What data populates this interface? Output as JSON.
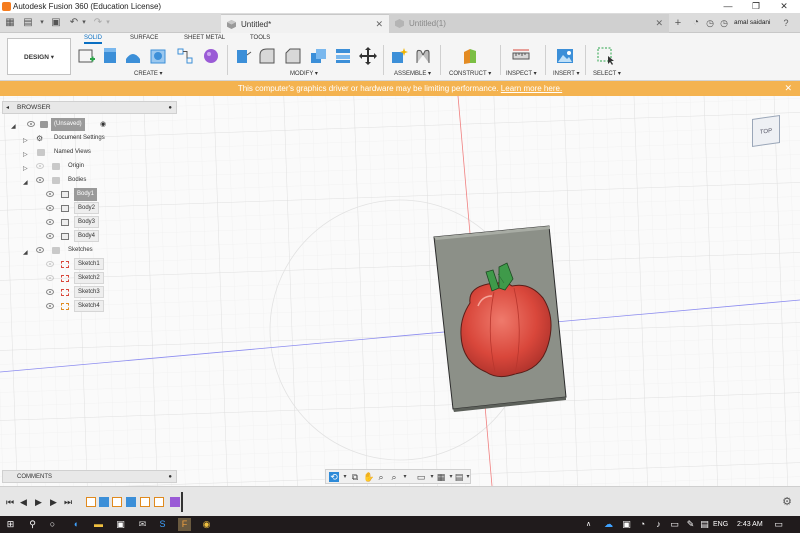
{
  "window": {
    "title": "Autodesk Fusion 360 (Education License)"
  },
  "tabs": [
    {
      "label": "Untitled*"
    },
    {
      "label": "Untitled(1)"
    }
  ],
  "user": {
    "name": "amal saidani"
  },
  "toolbar": {
    "workspace": "DESIGN ▾",
    "workspace_tabs": [
      "SOLID",
      "SURFACE",
      "SHEET METAL",
      "TOOLS"
    ],
    "groups": [
      "CREATE ▾",
      "MODIFY ▾",
      "ASSEMBLE ▾",
      "CONSTRUCT ▾",
      "INSPECT ▾",
      "INSERT ▾",
      "SELECT ▾"
    ]
  },
  "banner": {
    "message": "This computer's graphics driver or hardware may be limiting performance.",
    "link": "Learn more here."
  },
  "browser": {
    "title": "BROWSER",
    "root": "(Unsaved)",
    "items": [
      {
        "label": "Document Settings"
      },
      {
        "label": "Named Views"
      },
      {
        "label": "Origin"
      },
      {
        "label": "Bodies"
      },
      {
        "label": "Body1"
      },
      {
        "label": "Body2"
      },
      {
        "label": "Body3"
      },
      {
        "label": "Body4"
      },
      {
        "label": "Sketches"
      },
      {
        "label": "Sketch1"
      },
      {
        "label": "Sketch2"
      },
      {
        "label": "Sketch3"
      },
      {
        "label": "Sketch4"
      }
    ]
  },
  "viewcube": {
    "face": "TOP"
  },
  "comments": {
    "title": "COMMENTS"
  },
  "taskbar": {
    "lang": "ENG",
    "time": "2:43 AM"
  },
  "colors": {
    "banner": "#f4b350",
    "accent": "#0a6fc2",
    "pepper": "#d9473b",
    "stem": "#3f9a4a"
  }
}
